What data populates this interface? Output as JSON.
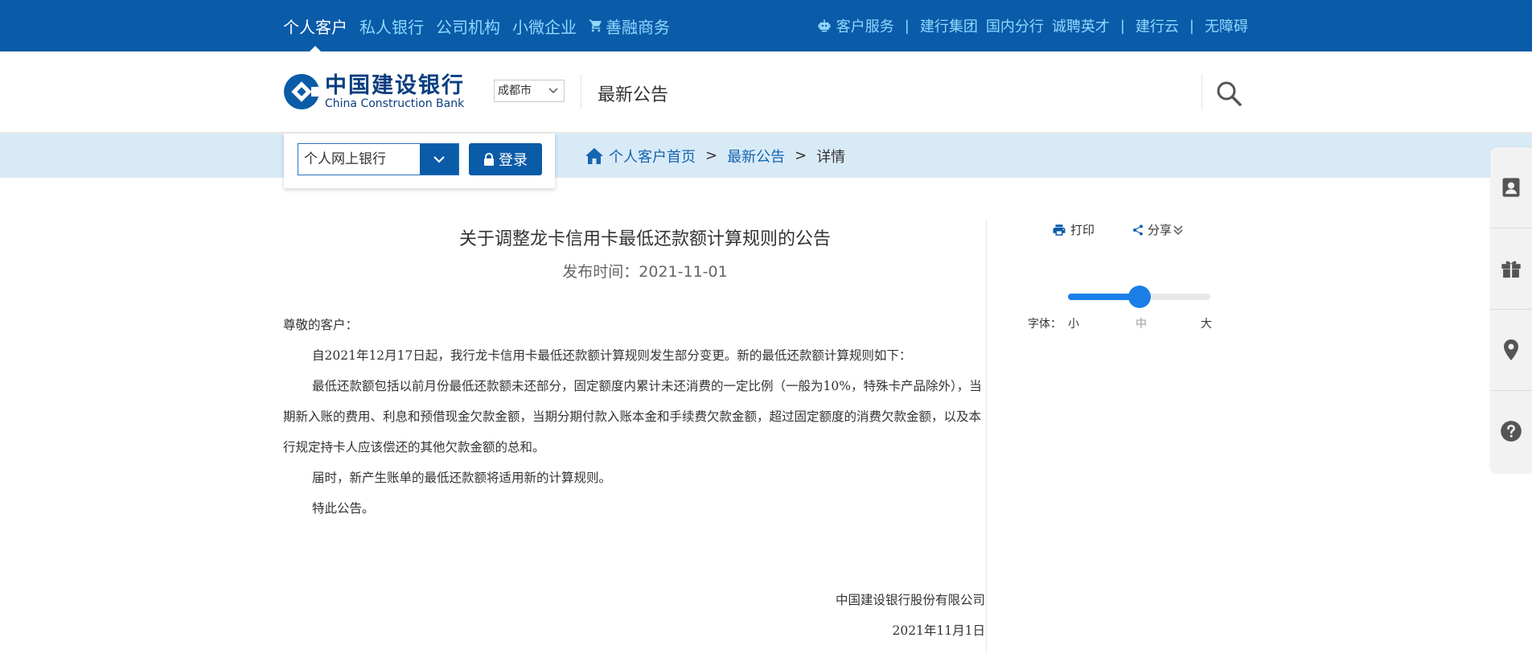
{
  "topnav": {
    "left": [
      "个人客户",
      "私人银行",
      "公司机构",
      "小微企业",
      "善融商务"
    ],
    "right": {
      "service": "客户服务",
      "group": "建行集团",
      "branch": "国内分行",
      "jobs": "诚聘英才",
      "cloud": "建行云",
      "accessible": "无障碍",
      "sep": "|"
    }
  },
  "header": {
    "logo_cn": "中国建设银行",
    "logo_en": "China Construction Bank",
    "city": "成都市",
    "section_title": "最新公告"
  },
  "login": {
    "select_value": "个人网上银行",
    "button_label": "登录"
  },
  "breadcrumb": {
    "home": "个人客户首页",
    "notice": "最新公告",
    "current": "详情",
    "sep": ">"
  },
  "article": {
    "title": "关于调整龙卡信用卡最低还款额计算规则的公告",
    "date_label": "发布时间：",
    "date": "2021-11-01",
    "greeting": "尊敬的客户：",
    "paragraphs": [
      "自2021年12月17日起，我行龙卡信用卡最低还款额计算规则发生部分变更。新的最低还款额计算规则如下：",
      "最低还款额包括以前月份最低还款额未还部分，固定额度内累计未还消费的一定比例（一般为10%，特殊卡产品除外），当期新入账的费用、利息和预借现金欠款金额，当期分期付款入账本金和手续费欠款金额，超过固定额度的消费欠款金额，以及本行规定持卡人应该偿还的其他欠款金额的总和。",
      "届时，新产生账单的最低还款额将适用新的计算规则。",
      "特此公告。"
    ],
    "signature": "中国建设银行股份有限公司",
    "sign_date": "2021年11月1日"
  },
  "tools": {
    "print": "打印",
    "share": "分享",
    "font_label": "字体：",
    "font_small": "小",
    "font_mid": "中",
    "font_big": "大",
    "font_level": 0.5
  },
  "colors": {
    "primary": "#0a5ba8",
    "nav_link": "#8fd8ff",
    "slider": "#1a7ee6",
    "crumb_bg": "#d9eaf7"
  },
  "icons": [
    "cart-icon",
    "robot-icon",
    "search-icon",
    "chevron-down-icon",
    "lock-icon",
    "home-icon",
    "print-icon",
    "share-icon",
    "double-chevron-down-icon",
    "user-card-icon",
    "gift-icon",
    "location-pin-icon",
    "help-icon"
  ]
}
